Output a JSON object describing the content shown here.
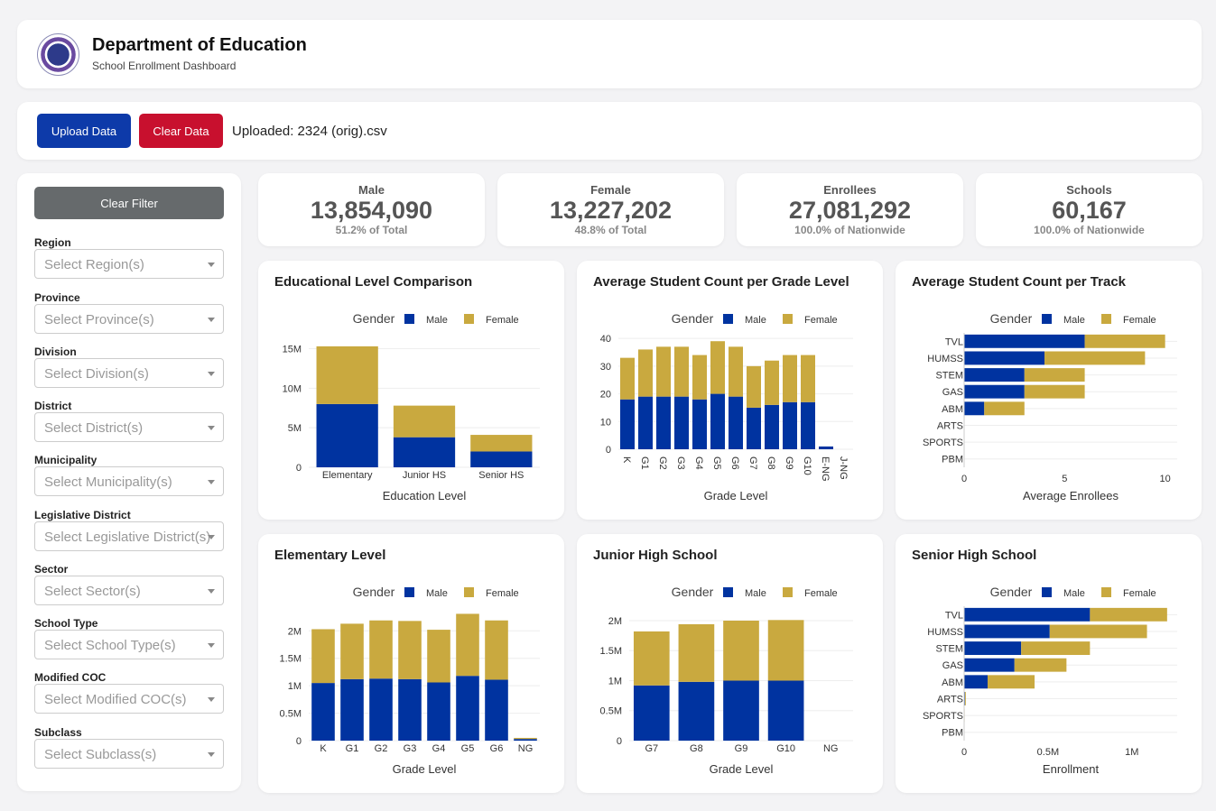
{
  "header": {
    "title": "Department of Education",
    "subtitle": "School Enrollment Dashboard"
  },
  "toolbar": {
    "upload_label": "Upload Data",
    "clear_label": "Clear Data",
    "uploaded_text": "Uploaded: 2324 (orig).csv"
  },
  "sidebar": {
    "clear_filter_label": "Clear Filter",
    "filters": [
      {
        "label": "Region",
        "placeholder": "Select Region(s)"
      },
      {
        "label": "Province",
        "placeholder": "Select Province(s)"
      },
      {
        "label": "Division",
        "placeholder": "Select Division(s)"
      },
      {
        "label": "District",
        "placeholder": "Select District(s)"
      },
      {
        "label": "Municipality",
        "placeholder": "Select Municipality(s)"
      },
      {
        "label": "Legislative District",
        "placeholder": "Select Legislative District(s)"
      },
      {
        "label": "Sector",
        "placeholder": "Select Sector(s)"
      },
      {
        "label": "School Type",
        "placeholder": "Select School Type(s)"
      },
      {
        "label": "Modified COC",
        "placeholder": "Select Modified COC(s)"
      },
      {
        "label": "Subclass",
        "placeholder": "Select Subclass(s)"
      }
    ]
  },
  "kpis": [
    {
      "label": "Male",
      "value": "13,854,090",
      "sub": "51.2% of Total"
    },
    {
      "label": "Female",
      "value": "13,227,202",
      "sub": "48.8% of Total"
    },
    {
      "label": "Enrollees",
      "value": "27,081,292",
      "sub": "100.0% of Nationwide"
    },
    {
      "label": "Schools",
      "value": "60,167",
      "sub": "100.0% of Nationwide"
    }
  ],
  "colors": {
    "male": "#0033a0",
    "female": "#c9a93f",
    "accent_blue": "#0d3aa9",
    "accent_red": "#c8102e"
  },
  "chart_data": [
    {
      "title": "Educational Level Comparison",
      "type": "bar",
      "orientation": "vertical",
      "stacked": true,
      "legend_title": "Gender",
      "xlabel": "Education Level",
      "ylabel": "",
      "categories": [
        "Elementary",
        "Junior HS",
        "Senior HS"
      ],
      "series": [
        {
          "name": "Male",
          "values": [
            8000000,
            3800000,
            2000000
          ]
        },
        {
          "name": "Female",
          "values": [
            7300000,
            4000000,
            2100000
          ]
        }
      ],
      "ylim": [
        0,
        17000000
      ],
      "yticks": [
        0,
        5000000,
        10000000,
        15000000
      ],
      "yticklabels": [
        "0",
        "5M",
        "10M",
        "15M"
      ],
      "xtick_rotated": false
    },
    {
      "title": "Average Student Count per Grade Level",
      "type": "bar",
      "orientation": "vertical",
      "stacked": true,
      "legend_title": "Gender",
      "xlabel": "Grade Level",
      "ylabel": "",
      "categories": [
        "K",
        "G1",
        "G2",
        "G3",
        "G4",
        "G5",
        "G6",
        "G7",
        "G8",
        "G9",
        "G10",
        "E-NG",
        "J-NG"
      ],
      "series": [
        {
          "name": "Male",
          "values": [
            18,
            19,
            19,
            19,
            18,
            20,
            19,
            15,
            16,
            17,
            17,
            1,
            0
          ]
        },
        {
          "name": "Female",
          "values": [
            15,
            17,
            18,
            18,
            16,
            19,
            18,
            15,
            16,
            17,
            17,
            0,
            0
          ]
        }
      ],
      "ylim": [
        0,
        42
      ],
      "yticks": [
        0,
        10,
        20,
        30,
        40
      ],
      "yticklabels": [
        "0",
        "10",
        "20",
        "30",
        "40"
      ],
      "xtick_rotated": true
    },
    {
      "title": "Average Student Count per Track",
      "type": "bar",
      "orientation": "horizontal",
      "stacked": true,
      "legend_title": "Gender",
      "xlabel": "Average Enrollees",
      "ylabel": "",
      "categories": [
        "TVL",
        "HUMSS",
        "STEM",
        "GAS",
        "ABM",
        "ARTS",
        "SPORTS",
        "PBM"
      ],
      "series": [
        {
          "name": "Male",
          "values": [
            6,
            4,
            3,
            3,
            1,
            0,
            0,
            0
          ]
        },
        {
          "name": "Female",
          "values": [
            4,
            5,
            3,
            3,
            2,
            0,
            0,
            0
          ]
        }
      ],
      "xlim": [
        0,
        10.6
      ],
      "xticks": [
        0,
        5,
        10
      ],
      "xticklabels": [
        "0",
        "5",
        "10"
      ]
    },
    {
      "title": "Elementary Level",
      "type": "bar",
      "orientation": "vertical",
      "stacked": true,
      "legend_title": "Gender",
      "xlabel": "Grade Level",
      "ylabel": "",
      "categories": [
        "K",
        "G1",
        "G2",
        "G3",
        "G4",
        "G5",
        "G6",
        "NG"
      ],
      "series": [
        {
          "name": "Male",
          "values": [
            1050000,
            1120000,
            1130000,
            1120000,
            1060000,
            1180000,
            1110000,
            30000
          ]
        },
        {
          "name": "Female",
          "values": [
            980000,
            1010000,
            1060000,
            1060000,
            960000,
            1130000,
            1080000,
            20000
          ]
        }
      ],
      "ylim": [
        0,
        2350000
      ],
      "yticks": [
        0,
        500000,
        1000000,
        1500000,
        2000000
      ],
      "yticklabels": [
        "0",
        "0.5M",
        "1M",
        "1.5M",
        "2M"
      ],
      "xtick_rotated": false
    },
    {
      "title": "Junior High School",
      "type": "bar",
      "orientation": "vertical",
      "stacked": true,
      "legend_title": "Gender",
      "xlabel": "Grade Level",
      "ylabel": "",
      "categories": [
        "G7",
        "G8",
        "G9",
        "G10",
        "NG"
      ],
      "series": [
        {
          "name": "Male",
          "values": [
            920000,
            980000,
            1000000,
            1000000,
            0
          ]
        },
        {
          "name": "Female",
          "values": [
            900000,
            960000,
            1000000,
            1010000,
            0
          ]
        }
      ],
      "ylim": [
        0,
        2150000
      ],
      "yticks": [
        0,
        500000,
        1000000,
        1500000,
        2000000
      ],
      "yticklabels": [
        "0",
        "0.5M",
        "1M",
        "1.5M",
        "2M"
      ],
      "xtick_rotated": false
    },
    {
      "title": "Senior High School",
      "type": "bar",
      "orientation": "horizontal",
      "stacked": true,
      "legend_title": "Gender",
      "xlabel": "Enrollment",
      "ylabel": "",
      "categories": [
        "TVL",
        "HUMSS",
        "STEM",
        "GAS",
        "ABM",
        "ARTS",
        "SPORTS",
        "PBM"
      ],
      "series": [
        {
          "name": "Male",
          "values": [
            750000,
            510000,
            340000,
            300000,
            140000,
            5000,
            2000,
            1000
          ]
        },
        {
          "name": "Female",
          "values": [
            460000,
            580000,
            410000,
            310000,
            280000,
            5000,
            1000,
            0
          ]
        }
      ],
      "xlim": [
        0,
        1270000
      ],
      "xticks": [
        0,
        500000,
        1000000
      ],
      "xticklabels": [
        "0",
        "0.5M",
        "1M"
      ]
    }
  ]
}
